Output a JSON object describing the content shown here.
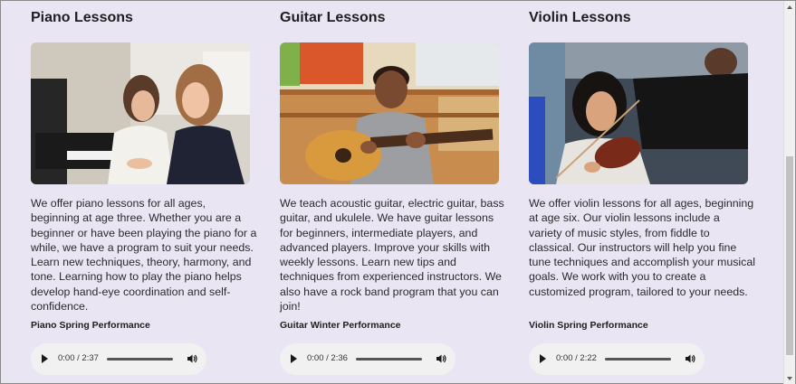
{
  "lessons": [
    {
      "title": "Piano Lessons",
      "description": "We offer piano lessons for all ages, beginning at age three. Whether you are a beginner or have been playing the piano for a while, we have a program to suit your needs. Learn new techniques, theory, harmony, and tone. Learning how to play the piano helps develop hand-eye coordination and self-confidence.",
      "performance": "Piano Spring Performance",
      "audio": {
        "time": "0:00 / 2:37"
      }
    },
    {
      "title": "Guitar Lessons",
      "description": "We teach acoustic guitar, electric guitar, bass guitar, and ukulele. We have guitar lessons for beginners, intermediate players, and advanced players. Improve your skills with weekly lessons. Learn new tips and techniques from experienced instructors. We also have a rock band program that you can join!",
      "performance": "Guitar Winter Performance",
      "audio": {
        "time": "0:00 / 2:36"
      }
    },
    {
      "title": "Violin Lessons",
      "description": "We offer violin lessons for all ages, beginning at age six. Our violin lessons include a variety of music styles, from fiddle to classical. Our instructors will help you fine tune techniques and accomplish your musical goals. We work with you to create a customized program, tailored to your needs.",
      "performance": "Violin Spring Performance",
      "audio": {
        "time": "0:00 / 2:22"
      }
    }
  ],
  "icons": {
    "play": "play-icon",
    "volume": "volume-icon",
    "scroll_up": "scroll-up-arrow-icon",
    "scroll_down": "scroll-down-arrow-icon"
  },
  "colors": {
    "page_background": "#e9e5f3",
    "player_background": "#f1f1f1"
  }
}
